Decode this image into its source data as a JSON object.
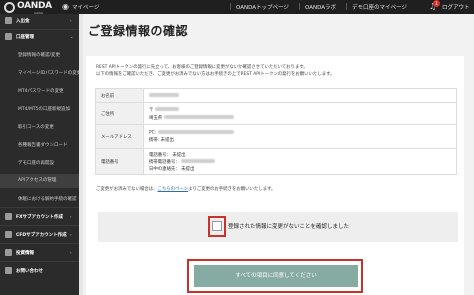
{
  "header": {
    "logo_text": "OANDA",
    "logo_sub": "JAPAN",
    "links": [
      "マイページ",
      "OANDAトップページ",
      "OANDAラボ",
      "デモ口座のマイページ"
    ],
    "logout_label": "ログアウト",
    "notification_count": "1"
  },
  "sidebar": {
    "items": [
      {
        "label": "入出金",
        "main": true
      },
      {
        "label": "口座管理",
        "main": true
      },
      {
        "label": "登録情報の確認/変更",
        "main": false
      },
      {
        "label": "マイページIDパスワードの変更",
        "main": false
      },
      {
        "label": "MT4パスワードの変更",
        "main": false
      },
      {
        "label": "MT4/MT5の口座新規追加",
        "main": false
      },
      {
        "label": "取引コースの変更",
        "main": false
      },
      {
        "label": "各種報告書ダウンロード",
        "main": false
      },
      {
        "label": "デモ口座の再開設",
        "main": false
      },
      {
        "label": "APIアクセスの管理",
        "main": false,
        "active": true
      },
      {
        "label": "休眠における解約手続の確認",
        "main": false
      },
      {
        "label": "FXサブアカウント作成",
        "main": true
      },
      {
        "label": "CFDサブアカウント作成",
        "main": true
      },
      {
        "label": "投資情報",
        "main": true
      },
      {
        "label": "お問い合わせ",
        "main": true
      }
    ]
  },
  "main": {
    "title": "ご登録情報の確認",
    "intro_lines": [
      "REST APIトークンの発行に先立って、お客様のご登録情報に変更がないか確認させていただいております。",
      "以下の情報をご確認いただき、ご変更がお済みでない方はお手続きの上でREST APIトークンの発行をお願いいたします。"
    ],
    "table": {
      "name_label": "お名前",
      "address_label": "ご住所",
      "address_postal": "〒",
      "address_line": "埼玉県",
      "email_label": "メールアドレス",
      "email_pc": "PC:",
      "email_mobile": "携帯:",
      "email_mobile_value": "未提出",
      "phone_label": "電話番号",
      "phone_lines": [
        "電話番号：",
        "携帯電話番号：",
        "日中の連絡先："
      ],
      "phone_values": [
        "未提出",
        "",
        "未提出"
      ]
    },
    "note_before": "ご変更がお済みでない場合は、",
    "note_link": "こちらのページ",
    "note_after": "よりご変更のお手続きをお願いいたします。",
    "confirm_label": "登録された情報に変更がないことを確認しました",
    "submit_label": "すべての項目に同意してください"
  },
  "colors": {
    "highlight": "#c8322a",
    "button": "#86aba3",
    "sidebar_bg": "#2b2b2b"
  }
}
